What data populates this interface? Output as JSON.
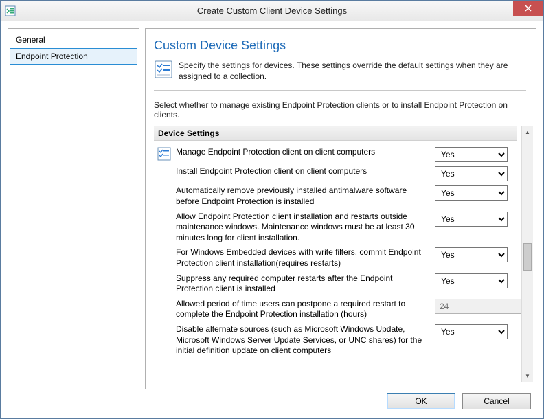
{
  "window": {
    "title": "Create Custom Client Device Settings"
  },
  "sidebar": {
    "items": [
      {
        "label": "General",
        "selected": false
      },
      {
        "label": "Endpoint Protection",
        "selected": true
      }
    ]
  },
  "main": {
    "title": "Custom Device Settings",
    "intro": "Specify the settings for devices. These settings override the default settings when they are assigned to a collection.",
    "subheading": "Select whether to manage existing Endpoint Protection clients or to install Endpoint Protection on clients.",
    "section_header": "Device Settings",
    "settings": [
      {
        "label": "Manage Endpoint Protection client on client computers",
        "value": "Yes",
        "type": "select",
        "icon": true
      },
      {
        "label": "Install Endpoint Protection client on client computers",
        "value": "Yes",
        "type": "select",
        "icon": false
      },
      {
        "label": "Automatically remove previously installed antimalware software before Endpoint Protection is installed",
        "value": "Yes",
        "type": "select",
        "icon": false
      },
      {
        "label": "Allow Endpoint Protection client installation and restarts outside maintenance windows. Maintenance windows must be at least 30 minutes long for client installation.",
        "value": "Yes",
        "type": "select",
        "icon": false
      },
      {
        "label": "For Windows Embedded devices with write filters, commit Endpoint Protection client installation(requires restarts)",
        "value": "Yes",
        "type": "select",
        "icon": false
      },
      {
        "label": "Suppress any required computer restarts after the Endpoint Protection client is installed",
        "value": "Yes",
        "type": "select",
        "icon": false
      },
      {
        "label": "Allowed period of time users can postpone a required restart to complete the Endpoint Protection installation (hours)",
        "value": "24",
        "type": "spinner",
        "icon": false
      },
      {
        "label": "Disable alternate sources (such as Microsoft Windows Update, Microsoft Windows Server Update Services, or UNC shares) for the initial definition update on client computers",
        "value": "Yes",
        "type": "select",
        "icon": false
      }
    ]
  },
  "footer": {
    "ok": "OK",
    "cancel": "Cancel"
  }
}
